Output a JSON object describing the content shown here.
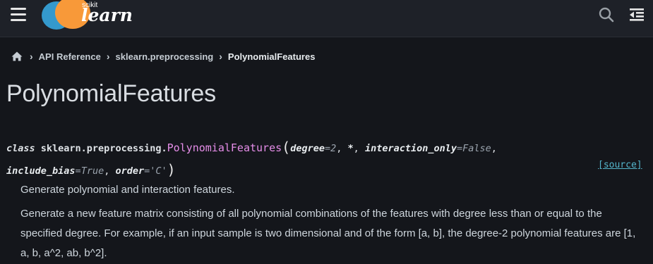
{
  "header": {
    "logo_small_text": "scikit",
    "logo_text": "learn",
    "menu_icon": "hamburger-icon",
    "search_icon": "search-icon",
    "toc_icon": "toc-toggle-icon",
    "colors": {
      "logo_blue": "#3499cd",
      "logo_orange": "#f89939"
    }
  },
  "breadcrumb": {
    "home_icon": "home-icon",
    "items": [
      "API Reference",
      "sklearn.preprocessing",
      "PolynomialFeatures"
    ]
  },
  "page": {
    "title": "PolynomialFeatures"
  },
  "signature": {
    "keyword": "class",
    "module_prefix": "sklearn.preprocessing.",
    "name": "PolynomialFeatures",
    "open_paren": "(",
    "close_paren": ")",
    "params": [
      {
        "name": "degree",
        "value": "2"
      },
      {
        "star": "*"
      },
      {
        "name": "interaction_only",
        "value": "False"
      },
      {
        "name": "include_bias",
        "value": "True"
      },
      {
        "name": "order",
        "value": "'C'"
      }
    ],
    "source_link": "[source]"
  },
  "description": {
    "summary": "Generate polynomial and interaction features.",
    "details": "Generate a new feature matrix consisting of all polynomial combinations of the features with degree less than or equal to the specified degree. For example, if an input sample is two dimensional and of the form [a, b], the degree-2 polynomial features are [1, a, b, a^2, ab, b^2]."
  }
}
